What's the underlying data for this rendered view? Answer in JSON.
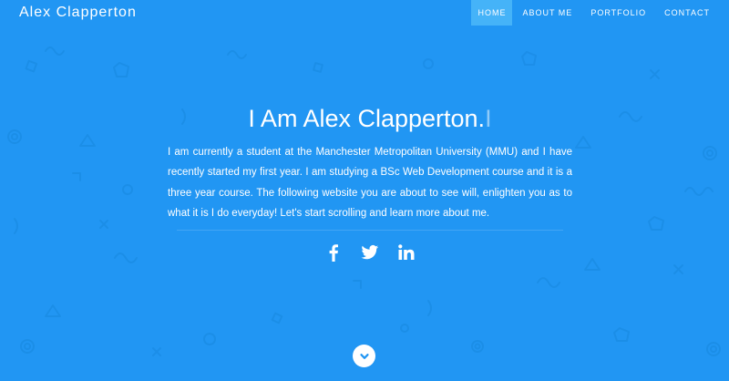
{
  "nav": {
    "brand": "Alex Clapperton",
    "items": [
      {
        "label": "HOME",
        "active": true
      },
      {
        "label": "ABOUT ME",
        "active": false
      },
      {
        "label": "PORTFOLIO",
        "active": false
      },
      {
        "label": "CONTACT",
        "active": false
      }
    ]
  },
  "hero": {
    "heading": "I Am Alex Clapperton.",
    "cursor": "I",
    "intro": "I am currently a student at the Manchester Metropolitan University (MMU) and I have recently started my first year. I am studying a BSc Web Development course and it is a three year course. The following website you are about to see will, enlighten you as to what it is I do everyday! Let's start scrolling and learn more about me."
  },
  "social": [
    {
      "icon": "facebook-icon"
    },
    {
      "icon": "twitter-icon"
    },
    {
      "icon": "linkedin-icon"
    }
  ],
  "scroll": {
    "icon": "chevron-down-icon"
  },
  "colors": {
    "background": "#2196f3",
    "active_nav": "#45b3f8",
    "text": "#ffffff",
    "scroll_chevron": "#2196f3"
  }
}
